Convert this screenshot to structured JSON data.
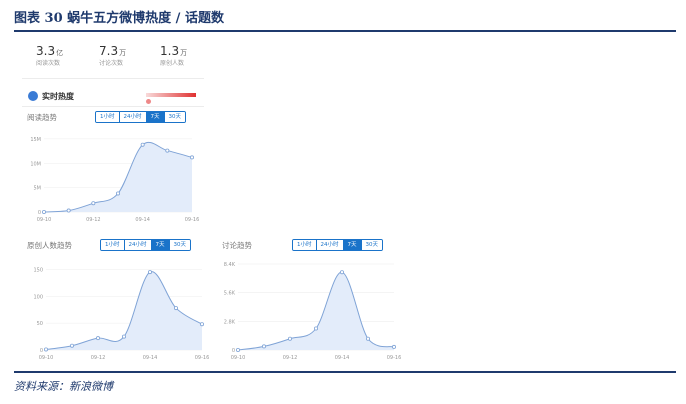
{
  "page": {
    "figure_title": "图表 30   蜗牛五方微博热度 / 话题数",
    "source": "资料来源：新浪微博"
  },
  "stats": [
    {
      "value": "3.3",
      "unit": "亿",
      "label": "阅读次数"
    },
    {
      "value": "7.3",
      "unit": "万",
      "label": "讨论次数"
    },
    {
      "value": "1.3",
      "unit": "万",
      "label": "原创人数"
    }
  ],
  "realtime": {
    "label": "实时热度"
  },
  "colors": {
    "accent": "#1a73c9",
    "line": "#7fa3d6",
    "fill": "#e3ecfa",
    "heat": "#e03131"
  },
  "chart_data": [
    {
      "id": "reading",
      "type": "area",
      "title": "阅读趋势",
      "tabs": [
        "1小时",
        "24小时",
        "7天",
        "30天"
      ],
      "active_tab": "7天",
      "x": [
        "09-10",
        "09-11",
        "09-12",
        "09-13",
        "09-14",
        "09-15",
        "09-16"
      ],
      "x_ticks": [
        "09-10",
        "09-12",
        "09-14",
        "09-16"
      ],
      "y": [
        0,
        3,
        18,
        38,
        138,
        126,
        112
      ],
      "ylim": [
        0,
        160
      ],
      "y_ticks": [
        0,
        50,
        100,
        150
      ],
      "y_tick_labels": [
        "0",
        "5M",
        "10M",
        "15M"
      ],
      "grid": true
    },
    {
      "id": "original",
      "type": "area",
      "title": "原创人数趋势",
      "tabs": [
        "1小时",
        "24小时",
        "7天",
        "30天"
      ],
      "active_tab": "7天",
      "x": [
        "09-10",
        "09-11",
        "09-12",
        "09-13",
        "09-14",
        "09-15",
        "09-16"
      ],
      "x_ticks": [
        "09-10",
        "09-12",
        "09-14",
        "09-16"
      ],
      "y": [
        1,
        8,
        22,
        25,
        145,
        78,
        48
      ],
      "ylim": [
        0,
        160
      ],
      "y_ticks": [
        0,
        50,
        100,
        150
      ],
      "y_tick_labels": [
        "0",
        "50",
        "100",
        "150"
      ],
      "grid": true
    },
    {
      "id": "discussion",
      "type": "area",
      "title": "讨论趋势",
      "tabs": [
        "1小时",
        "24小时",
        "7天",
        "30天"
      ],
      "active_tab": "7天",
      "x": [
        "09-10",
        "09-11",
        "09-12",
        "09-13",
        "09-14",
        "09-15",
        "09-16"
      ],
      "x_ticks": [
        "09-10",
        "09-12",
        "09-14",
        "09-16"
      ],
      "y": [
        0,
        350,
        1100,
        2100,
        7600,
        1100,
        300
      ],
      "ylim": [
        0,
        8400
      ],
      "y_ticks": [
        0,
        2800,
        5600,
        8400
      ],
      "y_tick_labels": [
        "0",
        "2.8K",
        "5.6K",
        "8.4K"
      ],
      "grid": true
    }
  ]
}
